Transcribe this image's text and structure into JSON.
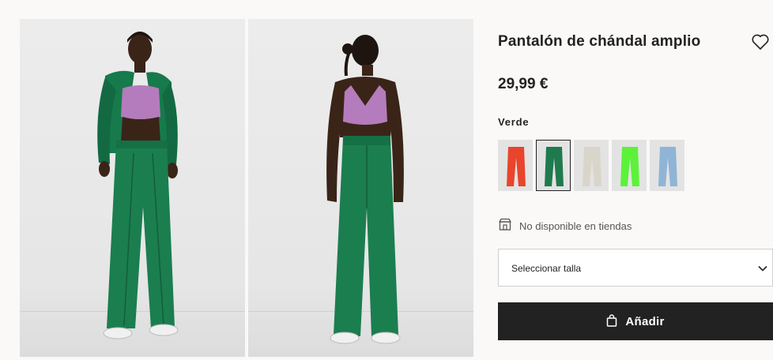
{
  "product": {
    "title": "Pantalón de chándal amplio",
    "price": "29,99 €",
    "color_label": "Verde",
    "colors": [
      {
        "name": "red",
        "hex": "#e8452c"
      },
      {
        "name": "green",
        "hex": "#1f7a4d"
      },
      {
        "name": "beige",
        "hex": "#d9d5ca"
      },
      {
        "name": "neon-green",
        "hex": "#5cf23a"
      },
      {
        "name": "light-blue",
        "hex": "#8fb4d6"
      }
    ],
    "selected_color_index": 1,
    "store_availability": "No disponible en tiendas",
    "size_select_placeholder": "Seleccionar talla",
    "add_button_label": "Añadir"
  },
  "icons": {
    "favorite": "heart-icon",
    "store": "store-icon",
    "dropdown": "chevron-down-icon",
    "bag": "bag-icon"
  },
  "colors": {
    "background": "#faf9f8",
    "primary_text": "#222222",
    "button_bg": "#222222",
    "button_text": "#ffffff",
    "muted_text": "#555555"
  }
}
